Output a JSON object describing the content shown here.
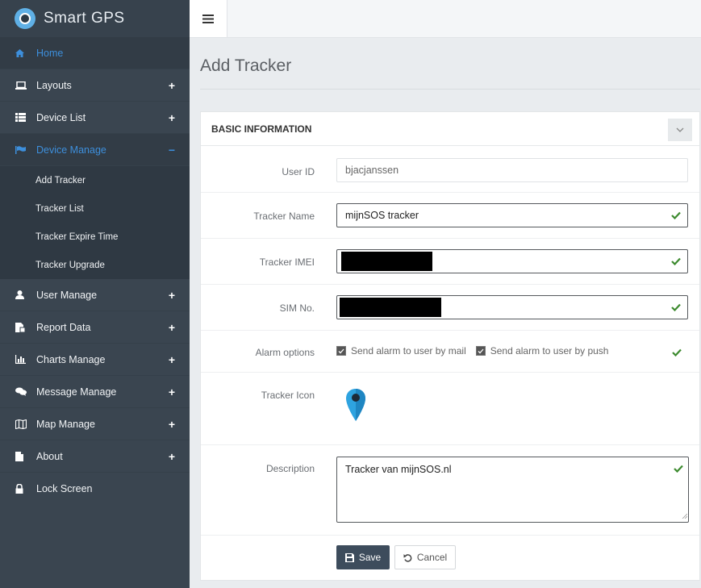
{
  "app": {
    "brand": "Smart GPS"
  },
  "sidebar": {
    "items": [
      {
        "label": "Home",
        "icon": "home-icon",
        "active": true
      },
      {
        "label": "Layouts",
        "icon": "laptop-icon",
        "toggle": "+"
      },
      {
        "label": "Device List",
        "icon": "list-icon",
        "toggle": "+"
      },
      {
        "label": "Device Manage",
        "icon": "flag-icon",
        "toggle": "−",
        "expanded": true
      },
      {
        "label": "User Manage",
        "icon": "user-icon",
        "toggle": "+"
      },
      {
        "label": "Report Data",
        "icon": "report-icon",
        "toggle": "+"
      },
      {
        "label": "Charts Manage",
        "icon": "bar-chart-icon",
        "toggle": "+"
      },
      {
        "label": "Message Manage",
        "icon": "chat-icon",
        "toggle": "+"
      },
      {
        "label": "Map Manage",
        "icon": "map-icon",
        "toggle": "+"
      },
      {
        "label": "About",
        "icon": "file-icon",
        "toggle": "+"
      },
      {
        "label": "Lock Screen",
        "icon": "lock-icon"
      }
    ],
    "submenu": [
      {
        "label": "Add Tracker"
      },
      {
        "label": "Tracker List"
      },
      {
        "label": "Tracker Expire Time"
      },
      {
        "label": "Tracker Upgrade"
      }
    ]
  },
  "page": {
    "title": "Add Tracker"
  },
  "panel": {
    "title": "BASIC INFORMATION",
    "fields": {
      "user_id": {
        "label": "User ID",
        "value": "bjacjanssen"
      },
      "tracker_name": {
        "label": "Tracker Name",
        "value": "mijnSOS tracker"
      },
      "tracker_imei": {
        "label": "Tracker IMEI",
        "value": ""
      },
      "sim_no": {
        "label": "SIM No.",
        "value": ""
      },
      "alarm": {
        "label": "Alarm options",
        "mail": "Send alarm to user by mail",
        "push": "Send alarm to user by push"
      },
      "icon": {
        "label": "Tracker Icon"
      },
      "description": {
        "label": "Description",
        "value": "Tracker van mijnSOS.nl"
      }
    },
    "buttons": {
      "save": "Save",
      "cancel": "Cancel"
    }
  },
  "colors": {
    "sidebar_bg": "#3a4550",
    "accent": "#3d8fdc",
    "valid_check": "#3c8a2e",
    "save_button": "#3d4c5c",
    "marker": "#2ea3e0"
  }
}
